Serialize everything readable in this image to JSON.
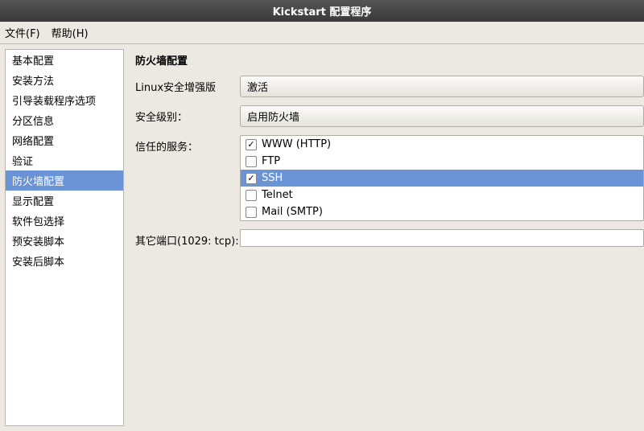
{
  "window": {
    "title": "Kickstart 配置程序"
  },
  "menubar": {
    "file": "文件(F)",
    "help": "帮助(H)"
  },
  "sidebar": {
    "items": [
      {
        "label": "基本配置",
        "selected": false
      },
      {
        "label": "安装方法",
        "selected": false
      },
      {
        "label": "引导装载程序选项",
        "selected": false
      },
      {
        "label": "分区信息",
        "selected": false
      },
      {
        "label": "网络配置",
        "selected": false
      },
      {
        "label": "验证",
        "selected": false
      },
      {
        "label": "防火墙配置",
        "selected": true
      },
      {
        "label": "显示配置",
        "selected": false
      },
      {
        "label": "软件包选择",
        "selected": false
      },
      {
        "label": "预安装脚本",
        "selected": false
      },
      {
        "label": "安装后脚本",
        "selected": false
      }
    ]
  },
  "content": {
    "title": "防火墙配置",
    "selinux_label": "Linux安全增强版",
    "selinux_value": "激活",
    "security_level_label": "安全级别：",
    "security_level_value": "启用防火墙",
    "trusted_services_label": "信任的服务：",
    "services": [
      {
        "label": "WWW (HTTP)",
        "checked": true,
        "selected": false
      },
      {
        "label": "FTP",
        "checked": false,
        "selected": false
      },
      {
        "label": "SSH",
        "checked": true,
        "selected": true
      },
      {
        "label": "Telnet",
        "checked": false,
        "selected": false
      },
      {
        "label": "Mail (SMTP)",
        "checked": false,
        "selected": false
      }
    ],
    "other_ports_label": "其它端口(1029: tcp):",
    "other_ports_value": ""
  }
}
